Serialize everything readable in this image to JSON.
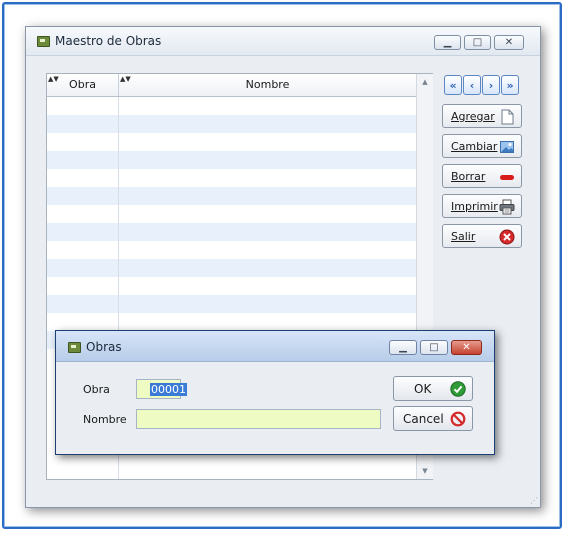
{
  "main_window": {
    "title": "Maestro de Obras",
    "controls": {
      "minimize": "▁",
      "maximize": "□",
      "close": "✕"
    }
  },
  "grid": {
    "columns": [
      "Obra",
      "Nombre"
    ],
    "sort_glyph": "▲▼",
    "rows": []
  },
  "navigation": {
    "first": "«",
    "prev": "‹",
    "next": "›",
    "last": "»"
  },
  "actions": {
    "agregar": "Agregar",
    "cambiar": "Cambiar",
    "borrar": "Borrar",
    "imprimir": "Imprimir",
    "salir": "Salir"
  },
  "dialog": {
    "title": "Obras",
    "controls": {
      "minimize": "▁",
      "maximize": "□",
      "close": "✕"
    },
    "fields": {
      "obra_label": "Obra",
      "obra_value": "00001",
      "nombre_label": "Nombre",
      "nombre_value": ""
    },
    "buttons": {
      "ok": "OK",
      "cancel": "Cancel"
    }
  },
  "icons": {
    "app": "app-icon",
    "agregar": "document-icon",
    "cambiar": "image-edit-icon",
    "borrar": "minus-icon",
    "imprimir": "printer-icon",
    "salir": "close-circle-icon",
    "ok": "check-circle-icon",
    "cancel": "no-entry-icon"
  },
  "colors": {
    "field_bg": "#eefcc3",
    "selection": "#3a7bd5",
    "row_alt": "#e8f1fb",
    "dialog_close": "#c4432f",
    "accent_border": "#2a6bc4"
  }
}
